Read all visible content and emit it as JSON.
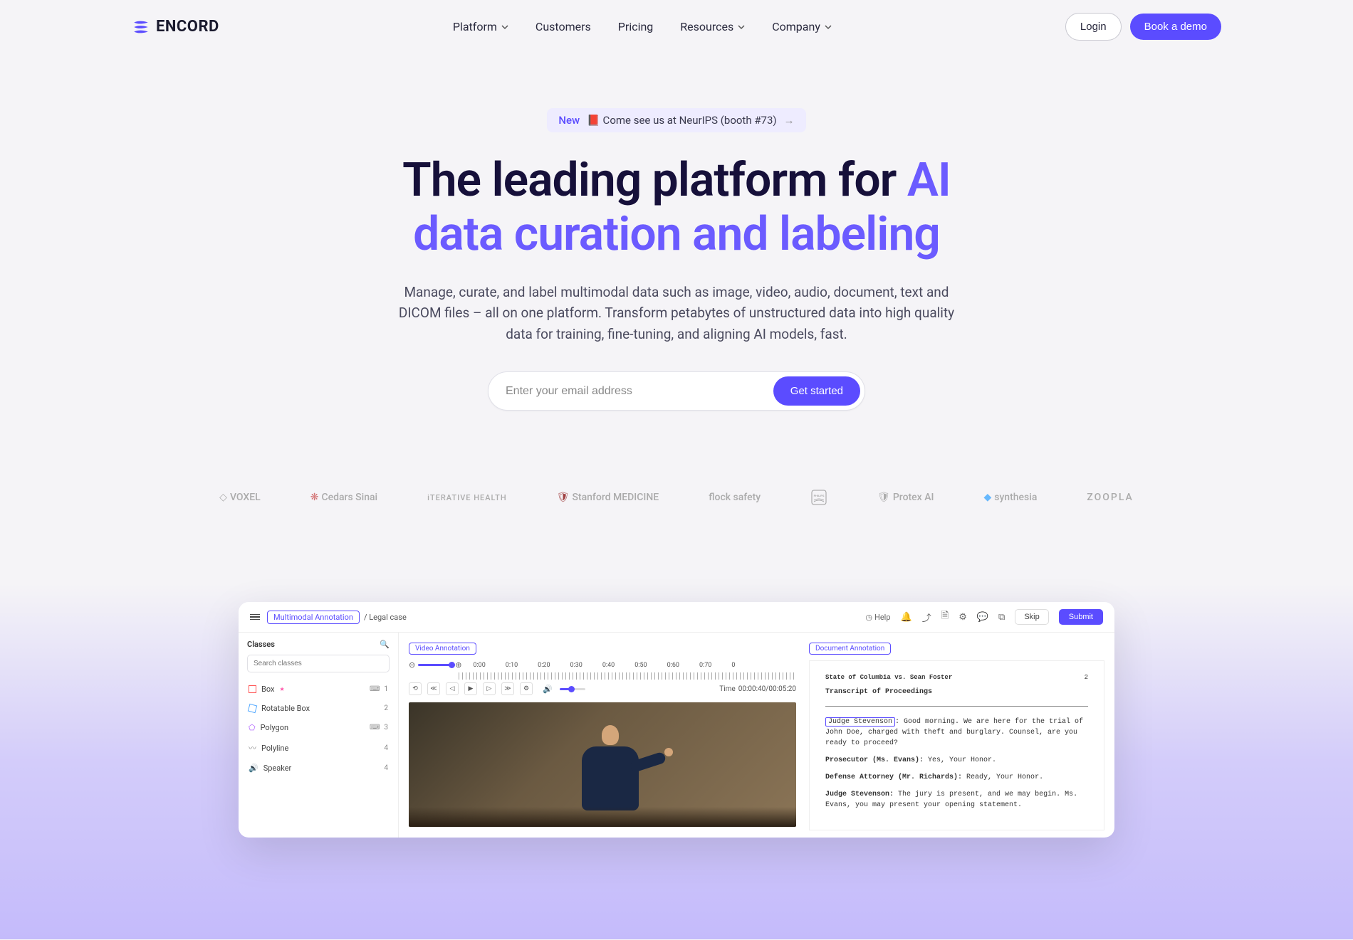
{
  "header": {
    "brand": "ENCORD",
    "nav": {
      "platform": "Platform",
      "customers": "Customers",
      "pricing": "Pricing",
      "resources": "Resources",
      "company": "Company"
    },
    "login": "Login",
    "demo": "Book a demo"
  },
  "announce": {
    "new": "New",
    "text": "📕 Come see us at NeurIPS (booth #73)"
  },
  "hero": {
    "title_pre": "The leading platform for ",
    "title_accent1": "AI",
    "title_accent2": "data curation and labeling",
    "subtitle": "Manage, curate, and label multimodal data such as image, video, audio, document, text and DICOM files – all on one platform. Transform petabytes of unstructured data into high quality data for training, fine-tuning, and aligning AI models, fast.",
    "email_placeholder": "Enter your email address",
    "get_started": "Get started"
  },
  "logos": {
    "voxel": "VOXEL",
    "cedars": "Cedars Sinai",
    "iterative": "iTERATIVE HEALTH",
    "stanford": "Stanford MEDICINE",
    "flock": "flock safety",
    "philips": "PHILIPS",
    "protex": "Protex AI",
    "synthesia": "synthesia",
    "zoopla": "ZOOPLA"
  },
  "app": {
    "breadcrumb_chip": "Multimodal Annotation",
    "breadcrumb_path": "/ Legal case",
    "help": "Help",
    "skip": "Skip",
    "submit": "Submit",
    "sidebar": {
      "title": "Classes",
      "search_placeholder": "Search classes",
      "items": [
        {
          "label": "Box",
          "count": "1"
        },
        {
          "label": "Rotatable Box",
          "count": "2"
        },
        {
          "label": "Polygon",
          "count": "3"
        },
        {
          "label": "Polyline",
          "count": "4"
        },
        {
          "label": "Speaker",
          "count": "4"
        }
      ]
    },
    "video": {
      "tag": "Video Annotation",
      "ticks": [
        "0:00",
        "0:10",
        "0:20",
        "0:30",
        "0:40",
        "0:50",
        "0:60",
        "0:70",
        "0"
      ],
      "time_label": "Time",
      "time_value": "00:00:40/00:05:20"
    },
    "doc": {
      "tag": "Document Annotation",
      "case": "State of Columbia vs. Sean Foster",
      "page": "2",
      "title": "Transcript of Proceedings",
      "judge_name": "Judge Stevenson",
      "judge_line": ": Good morning. We are here for the trial of John Doe, charged with theft and burglary. Counsel, are you ready to proceed?",
      "prosecutor": "Prosecutor (Ms. Evans): ",
      "prosecutor_text": "Yes, Your Honor.",
      "defense": "Defense Attorney (Mr. Richards): ",
      "defense_text": "Ready, Your Honor.",
      "judge2": "Judge Stevenson: ",
      "judge2_text": "The jury is present, and we may begin. Ms. Evans, you may present your opening statement."
    }
  }
}
